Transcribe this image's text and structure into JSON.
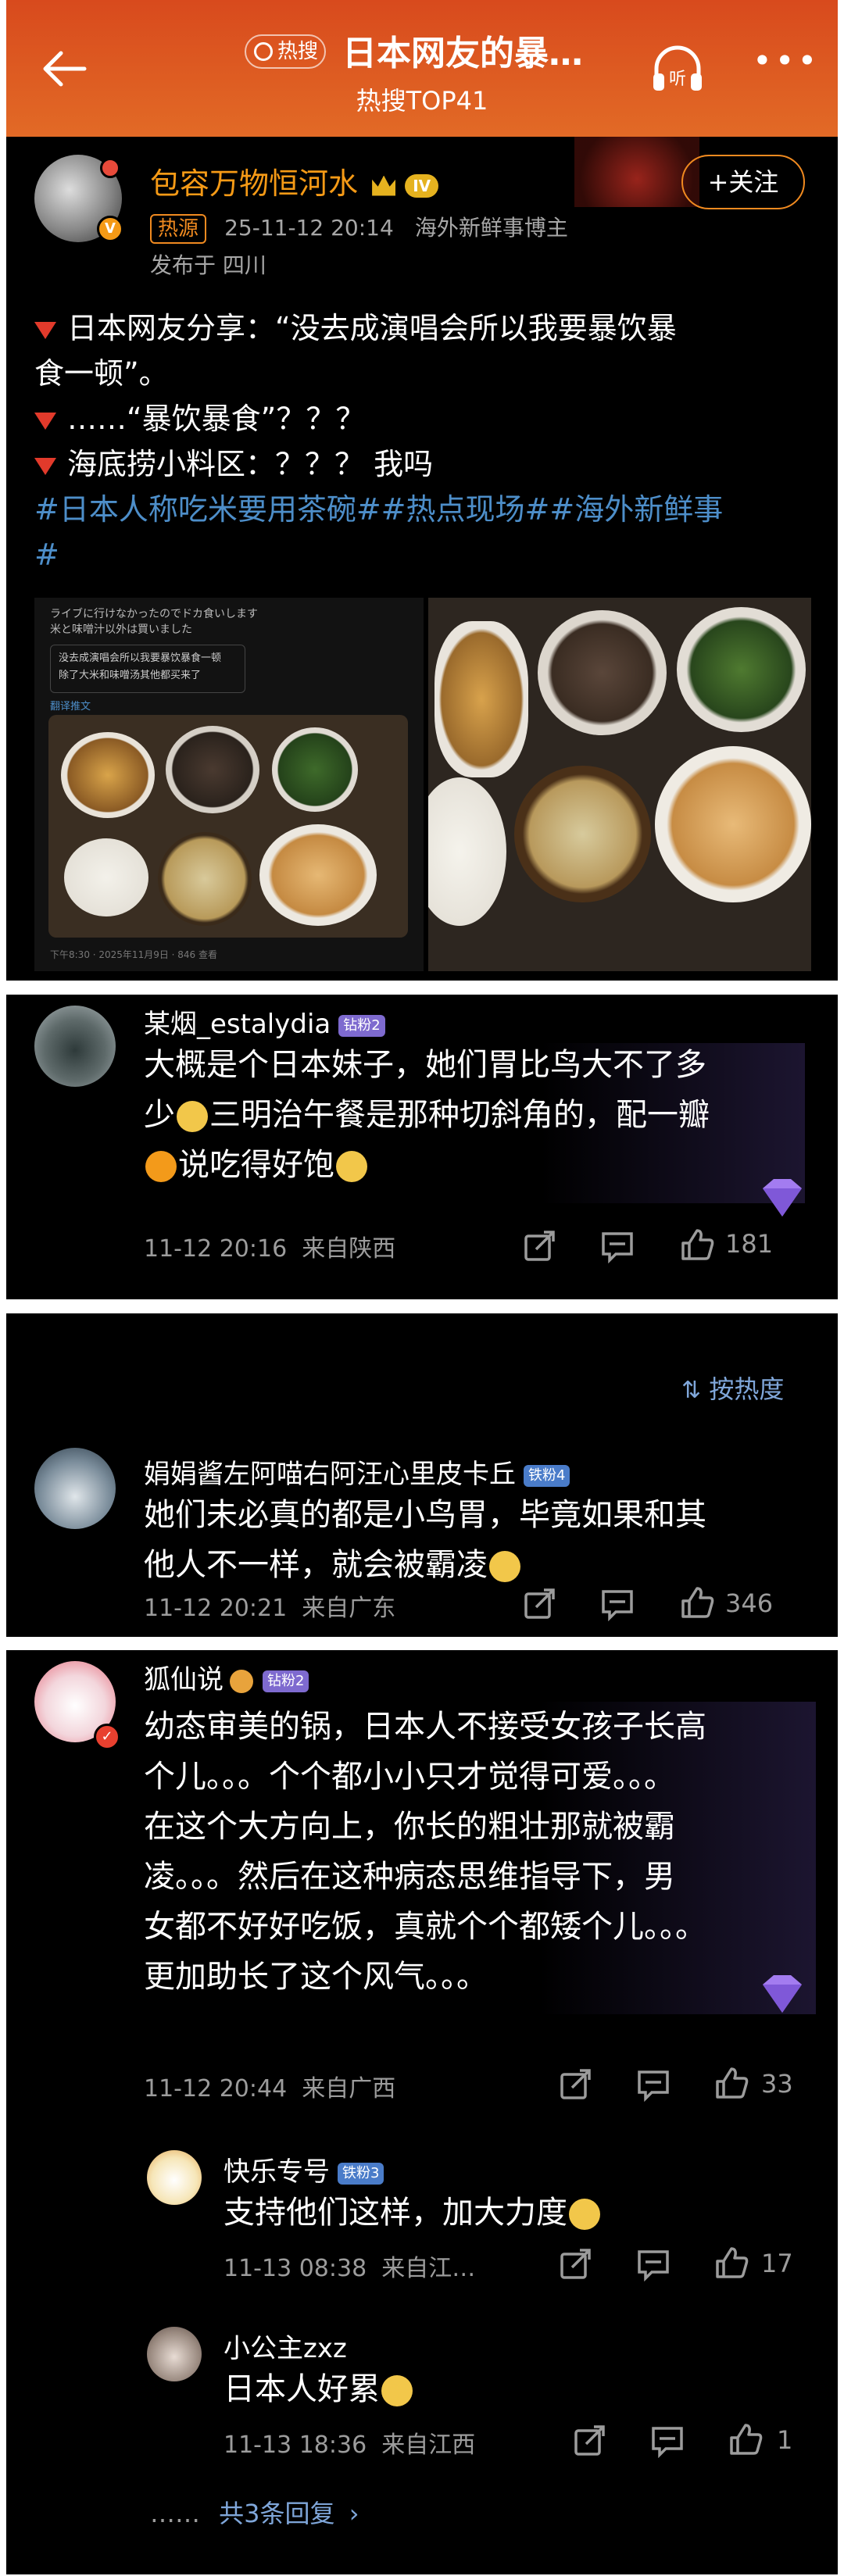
{
  "header": {
    "hot_tag": "热搜",
    "title": "日本网友的暴…",
    "subtitle": "热搜TOP41",
    "listen_label": "听"
  },
  "post": {
    "author": "包容万物恒河水",
    "level": "IV",
    "hot_source": "热源",
    "time": "25-11-12 20:14",
    "author_desc": "海外新鲜事博主",
    "location": "发布于 四川",
    "follow_label": "+关注",
    "lines": [
      "日本网友分享：“没去成演唱会所以我要暴饮暴",
      "食一顿”。",
      "……“暴饮暴食”？？？",
      "海底捞小料区：？？？ 我吗"
    ],
    "hashtags_line1": "#日本人称吃米要用茶碗##热点现场##海外新鲜事",
    "hashtags_line2": "#"
  },
  "comments": {
    "c1": {
      "name": "某烟_estalydia",
      "badge": "钻粉2",
      "text_l1": "大概是个日本妹子，她们胃比鸟大不了多",
      "text_l2a": "少",
      "text_l2b": "三明治午餐是那种切斜角的，配一瓣",
      "text_l3": "说吃得好饱",
      "time": "11-12 20:16",
      "from": "来自陕西",
      "likes": "181"
    },
    "sort_label": "按热度",
    "c2": {
      "name": "娟娟酱左阿喵右阿汪心里皮卡丘",
      "badge": "铁粉4",
      "text_l1": "她们未必真的都是小鸟胃，毕竟如果和其",
      "text_l2": "他人不一样，就会被霸凌",
      "time": "11-12 20:21",
      "from": "来自广东",
      "likes": "346"
    },
    "c3": {
      "name": "狐仙说",
      "badge": "钻粉2",
      "lines": [
        "幼态审美的锅，日本人不接受女孩子长高",
        "个儿。。。个个都小小只才觉得可爱。。。",
        "在这个大方向上，你长的粗壮那就被霸",
        "凌。。。然后在这种病态思维指导下，男",
        "女都不好好吃饭，真就个个都矮个儿。。。",
        "更加助长了这个风气。。。"
      ],
      "time": "11-12 20:44",
      "from": "来自广西",
      "likes": "33"
    },
    "r1": {
      "name": "快乐专号",
      "badge": "铁粉3",
      "text": "支持他们这样，加大力度",
      "time": "11-13 08:38",
      "from": "来自江…",
      "likes": "17"
    },
    "r2": {
      "name": "小公主zxz",
      "text": "日本人好累",
      "time": "11-13 18:36",
      "from": "来自江西",
      "likes": "1"
    },
    "more_replies": "共3条回复",
    "dots": "……"
  },
  "screenshot_text": {
    "l1": "ライブに行けなかったのでドカ食いします",
    "l2": "米と味噌汁以外は買いました",
    "box1": "没去成演唱会所以我要暴饮暴食一顿",
    "box2": "除了大米和味噌汤其他都买来了",
    "link": "翻译推文",
    "foot": "下午8:30 · 2025年11月9日 · 846 查看"
  },
  "colors": {
    "header_orange": "#e05a22",
    "accent_orange": "#f08a20",
    "hashtag_blue": "#4d8ec9",
    "card_bg": "#000000"
  }
}
